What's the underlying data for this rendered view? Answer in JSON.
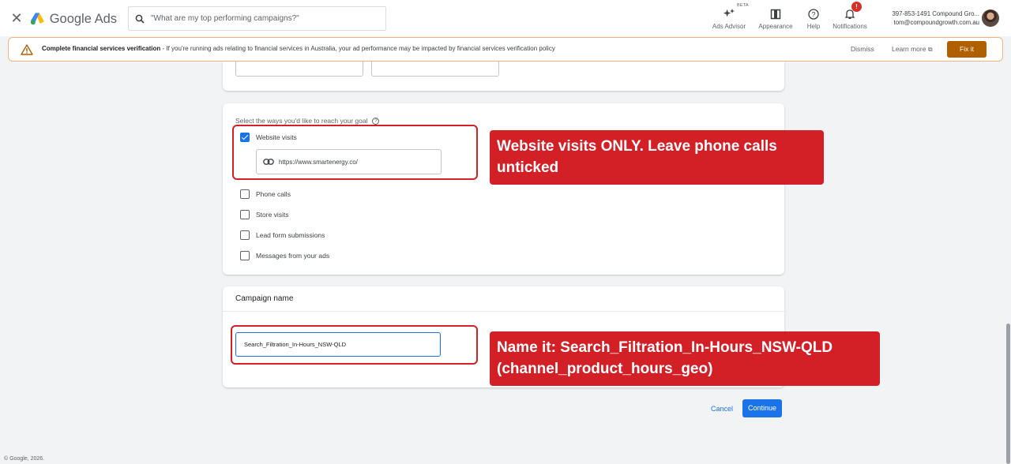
{
  "header": {
    "app_name": "Google Ads",
    "search_placeholder": "\"What are my top performing campaigns?\"",
    "tools": [
      {
        "label": "Ads Advisor",
        "icon": "sparkle-icon"
      },
      {
        "label": "Appearance",
        "icon": "appearance-icon"
      },
      {
        "label": "Help",
        "icon": "help-icon"
      },
      {
        "label": "Notifications",
        "icon": "bell-icon"
      }
    ],
    "beta_label": "BETA",
    "notification_count": "!",
    "account_line1": "397-853-1491 Compound Gro...",
    "account_line2": "tom@compoundgrowth.com.au"
  },
  "banner": {
    "title": "Complete financial services verification",
    "message": " - If you're running ads relating to financial services in Australia, your ad performance may be impacted by financial services verification policy",
    "dismiss": "Dismiss",
    "learn_more": "Learn more",
    "fix_it": "Fix it",
    "color": "#b06000"
  },
  "goal_card": {
    "title": "Select the ways you'd like to reach your goal",
    "options": [
      {
        "label": "Website visits",
        "checked": true
      },
      {
        "label": "Phone calls",
        "checked": false
      },
      {
        "label": "Store visits",
        "checked": false
      },
      {
        "label": "Lead form submissions",
        "checked": false
      },
      {
        "label": "Messages from your ads",
        "checked": false
      }
    ],
    "website_url": "https://www.smartenergy.co/"
  },
  "name_card": {
    "title": "Campaign name",
    "value": "Search_Filtration_In-Hours_NSW-QLD"
  },
  "annotations": {
    "goal_note": "Website visits ONLY. Leave phone calls unticked",
    "name_note_line1": "Name it: Search_Filtration_In-Hours_NSW-QLD",
    "name_note_line2": "(channel_product_hours_geo)",
    "color": "#d32027"
  },
  "footer": {
    "cancel": "Cancel",
    "continue": "Continue",
    "copyright": "© Google, 2026."
  },
  "colors": {
    "primary": "#1a73e8",
    "page_bg": "#f1f3f4"
  }
}
